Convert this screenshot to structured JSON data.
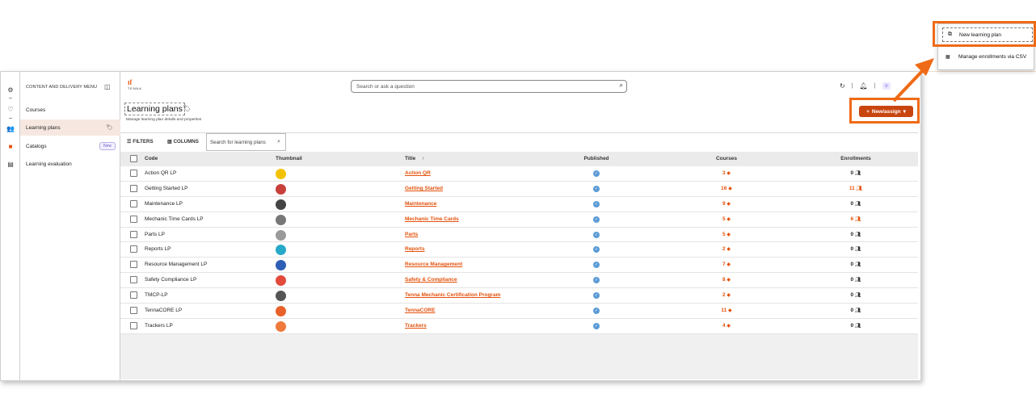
{
  "colors": {
    "accent": "#e3520c",
    "highlight": "#ef6a16",
    "button": "#c94510"
  },
  "rail_icons": [
    "gear-icon",
    "heart-icon",
    "people-icon",
    "book-icon",
    "clipboard-icon"
  ],
  "menu": {
    "heading": "CONTENT AND DELIVERY MENU",
    "items": [
      {
        "label": "Courses"
      },
      {
        "label": "Learning plans"
      },
      {
        "label": "Catalogs",
        "badge": "New"
      },
      {
        "label": "Learning evaluation"
      }
    ]
  },
  "header": {
    "logo_text": "TENNA",
    "search_placeholder": "Search or ask a question"
  },
  "page": {
    "title": "Learning plans",
    "subtitle": "Manage learning plan details and properties",
    "new_button": "New/assign"
  },
  "toolbar": {
    "filters": "FILTERS",
    "columns": "COLUMNS",
    "search_placeholder": "Search for learning plans"
  },
  "table": {
    "columns": [
      "Code",
      "Thumbnail",
      "Title",
      "Published",
      "Courses",
      "Enrollments"
    ],
    "title_sort": "↑",
    "rows": [
      {
        "code": "Action QR LP",
        "title": "Action QR",
        "courses": "3",
        "enrollments": "0",
        "thumb": "#f2c200"
      },
      {
        "code": "Getting Started LP",
        "title": "Getting Started",
        "courses": "16",
        "enrollments": "11",
        "thumb": "#c8403a"
      },
      {
        "code": "Maintenance LP",
        "title": "Maintenance",
        "courses": "9",
        "enrollments": "0",
        "thumb": "#444444"
      },
      {
        "code": "Mechanic Time Cards LP",
        "title": "Mechanic Time Cards",
        "courses": "5",
        "enrollments": "6",
        "thumb": "#777777"
      },
      {
        "code": "Parts LP",
        "title": "Parts",
        "courses": "5",
        "enrollments": "0",
        "thumb": "#9a9a9a"
      },
      {
        "code": "Reports LP",
        "title": "Reports",
        "courses": "2",
        "enrollments": "0",
        "thumb": "#27a9c9"
      },
      {
        "code": "Resource Management LP",
        "title": "Resource Management",
        "courses": "7",
        "enrollments": "0",
        "thumb": "#2c5fb5"
      },
      {
        "code": "Safety Compliance LP",
        "title": "Safety & Compliance",
        "courses": "8",
        "enrollments": "0",
        "thumb": "#e24a3b"
      },
      {
        "code": "TMCP-LP",
        "title": "Tenna Mechanic Certification Program",
        "courses": "2",
        "enrollments": "0",
        "thumb": "#555555"
      },
      {
        "code": "TennaCORE LP",
        "title": "TennaCORE",
        "courses": "11",
        "enrollments": "0",
        "thumb": "#e8602a"
      },
      {
        "code": "Trackers LP",
        "title": "Trackers",
        "courses": "4",
        "enrollments": "0",
        "thumb": "#ef7a3c"
      }
    ]
  },
  "dropdown": {
    "items": [
      {
        "label": "New learning plan",
        "icon": "copy-icon"
      },
      {
        "label": "Manage enrollments via CSV",
        "icon": "csv-icon"
      }
    ]
  }
}
